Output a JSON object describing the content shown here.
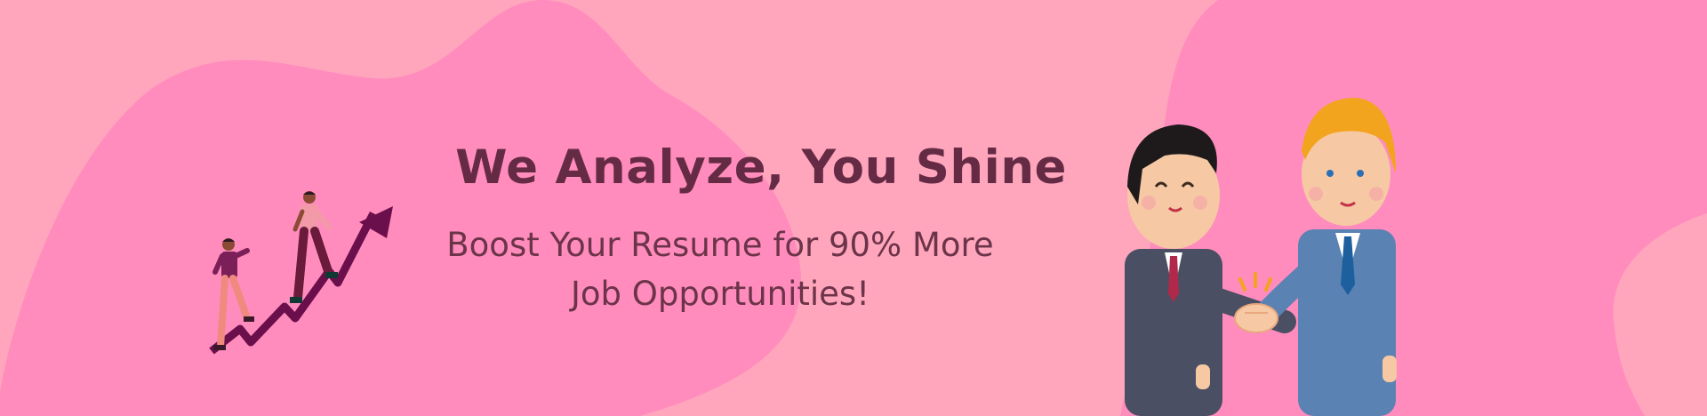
{
  "hero": {
    "headline": "We Analyze, You Shine",
    "subline_1": "Boost Your Resume for 90% More",
    "subline_2": "Job Opportunities!"
  },
  "colors": {
    "background": "#ffa6bd",
    "blob": "#ff8cbd",
    "headline": "#652a44",
    "subline": "#6c3449",
    "arrow": "#6b0f4c"
  },
  "illustrations": [
    "stair-arrow-climbers-illustration",
    "business-handshake-illustration"
  ]
}
